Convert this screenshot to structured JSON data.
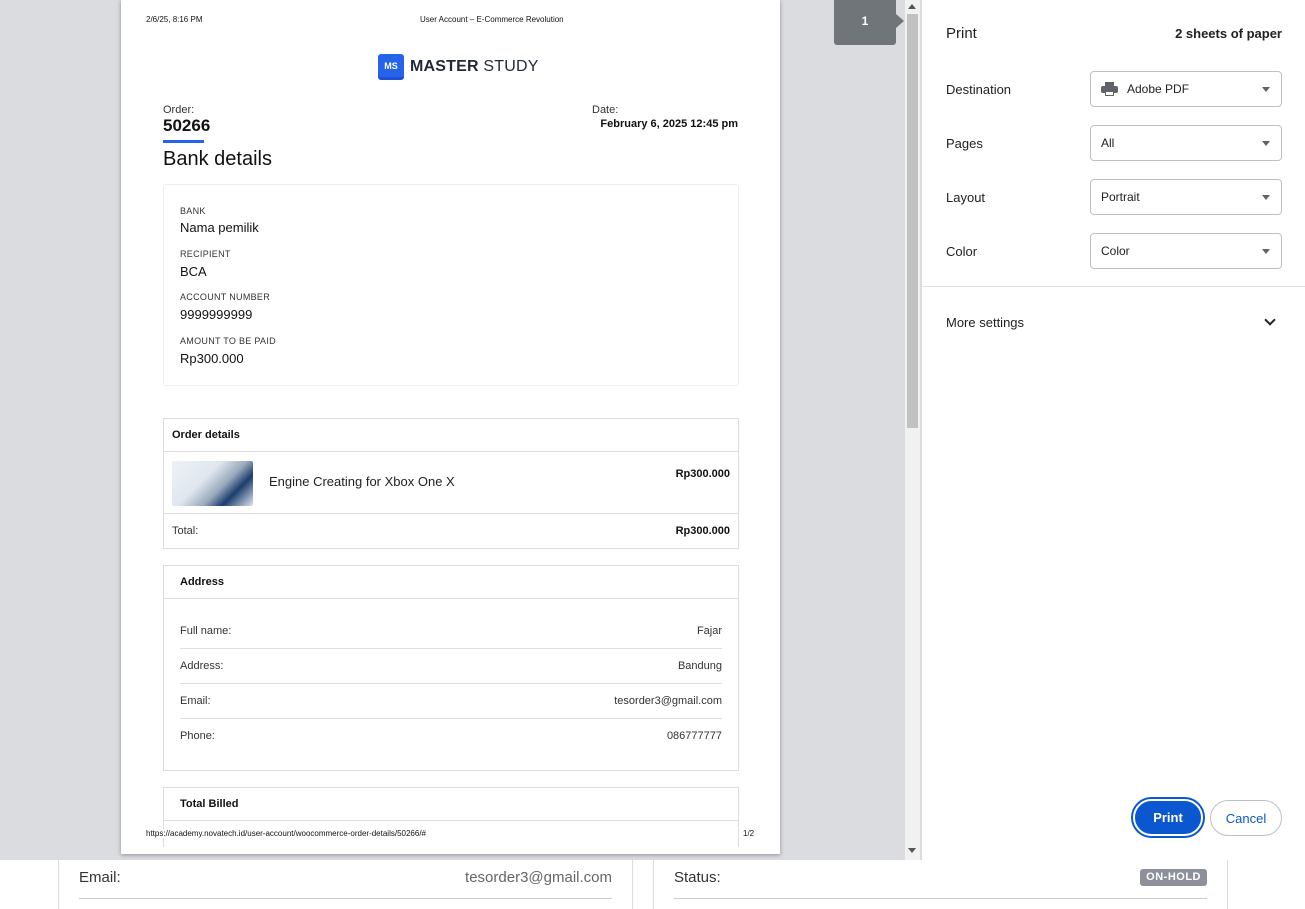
{
  "background": {
    "email_label": "Email:",
    "email_value": "tesorder3@gmail.com",
    "status_label": "Status:",
    "status_badge": "ON-HOLD"
  },
  "preview": {
    "page_indicator": "1",
    "header_left": "2/6/25, 8:16 PM",
    "header_center": "User Account – E-Commerce Revolution",
    "footer_url": "https://academy.novatech.id/user-account/woocommerce-order-details/50266/#",
    "footer_page": "1/2",
    "logo": {
      "mark": "MS",
      "bold": "MASTER",
      "rest": " STUDY"
    },
    "order_label": "Order:",
    "order_number": "50266",
    "date_label": "Date:",
    "date_value": "February 6, 2025 12:45 pm",
    "bank_title": "Bank details",
    "bank": {
      "bank_label": "BANK",
      "bank_value": "Nama pemilik",
      "recipient_label": "RECIPIENT",
      "recipient_value": "BCA",
      "account_label": "ACCOUNT NUMBER",
      "account_value": "9999999999",
      "amount_label": "AMOUNT TO BE PAID",
      "amount_value": "Rp300.000"
    },
    "order_details": {
      "title": "Order details",
      "item_name": "Engine Creating for Xbox One X",
      "item_price": "Rp300.000",
      "total_label": "Total:",
      "total_value": "Rp300.000"
    },
    "address": {
      "title": "Address",
      "rows": [
        {
          "label": "Full name:",
          "value": "Fajar"
        },
        {
          "label": "Address:",
          "value": "Bandung"
        },
        {
          "label": "Email:",
          "value": "tesorder3@gmail.com"
        },
        {
          "label": "Phone:",
          "value": "086777777"
        }
      ]
    },
    "total_billed_title": "Total Billed"
  },
  "sidebar": {
    "title": "Print",
    "sheets": "2 sheets of paper",
    "destination_label": "Destination",
    "destination_value": "Adobe PDF",
    "pages_label": "Pages",
    "pages_value": "All",
    "layout_label": "Layout",
    "layout_value": "Portrait",
    "color_label": "Color",
    "color_value": "Color",
    "more_settings": "More settings",
    "print_button": "Print",
    "cancel_button": "Cancel"
  },
  "colors": {
    "accent": "#0b57d0",
    "brand_blue": "#2563eb",
    "preview_bg": "#dadce0",
    "badge_gray": "#8b9099"
  }
}
